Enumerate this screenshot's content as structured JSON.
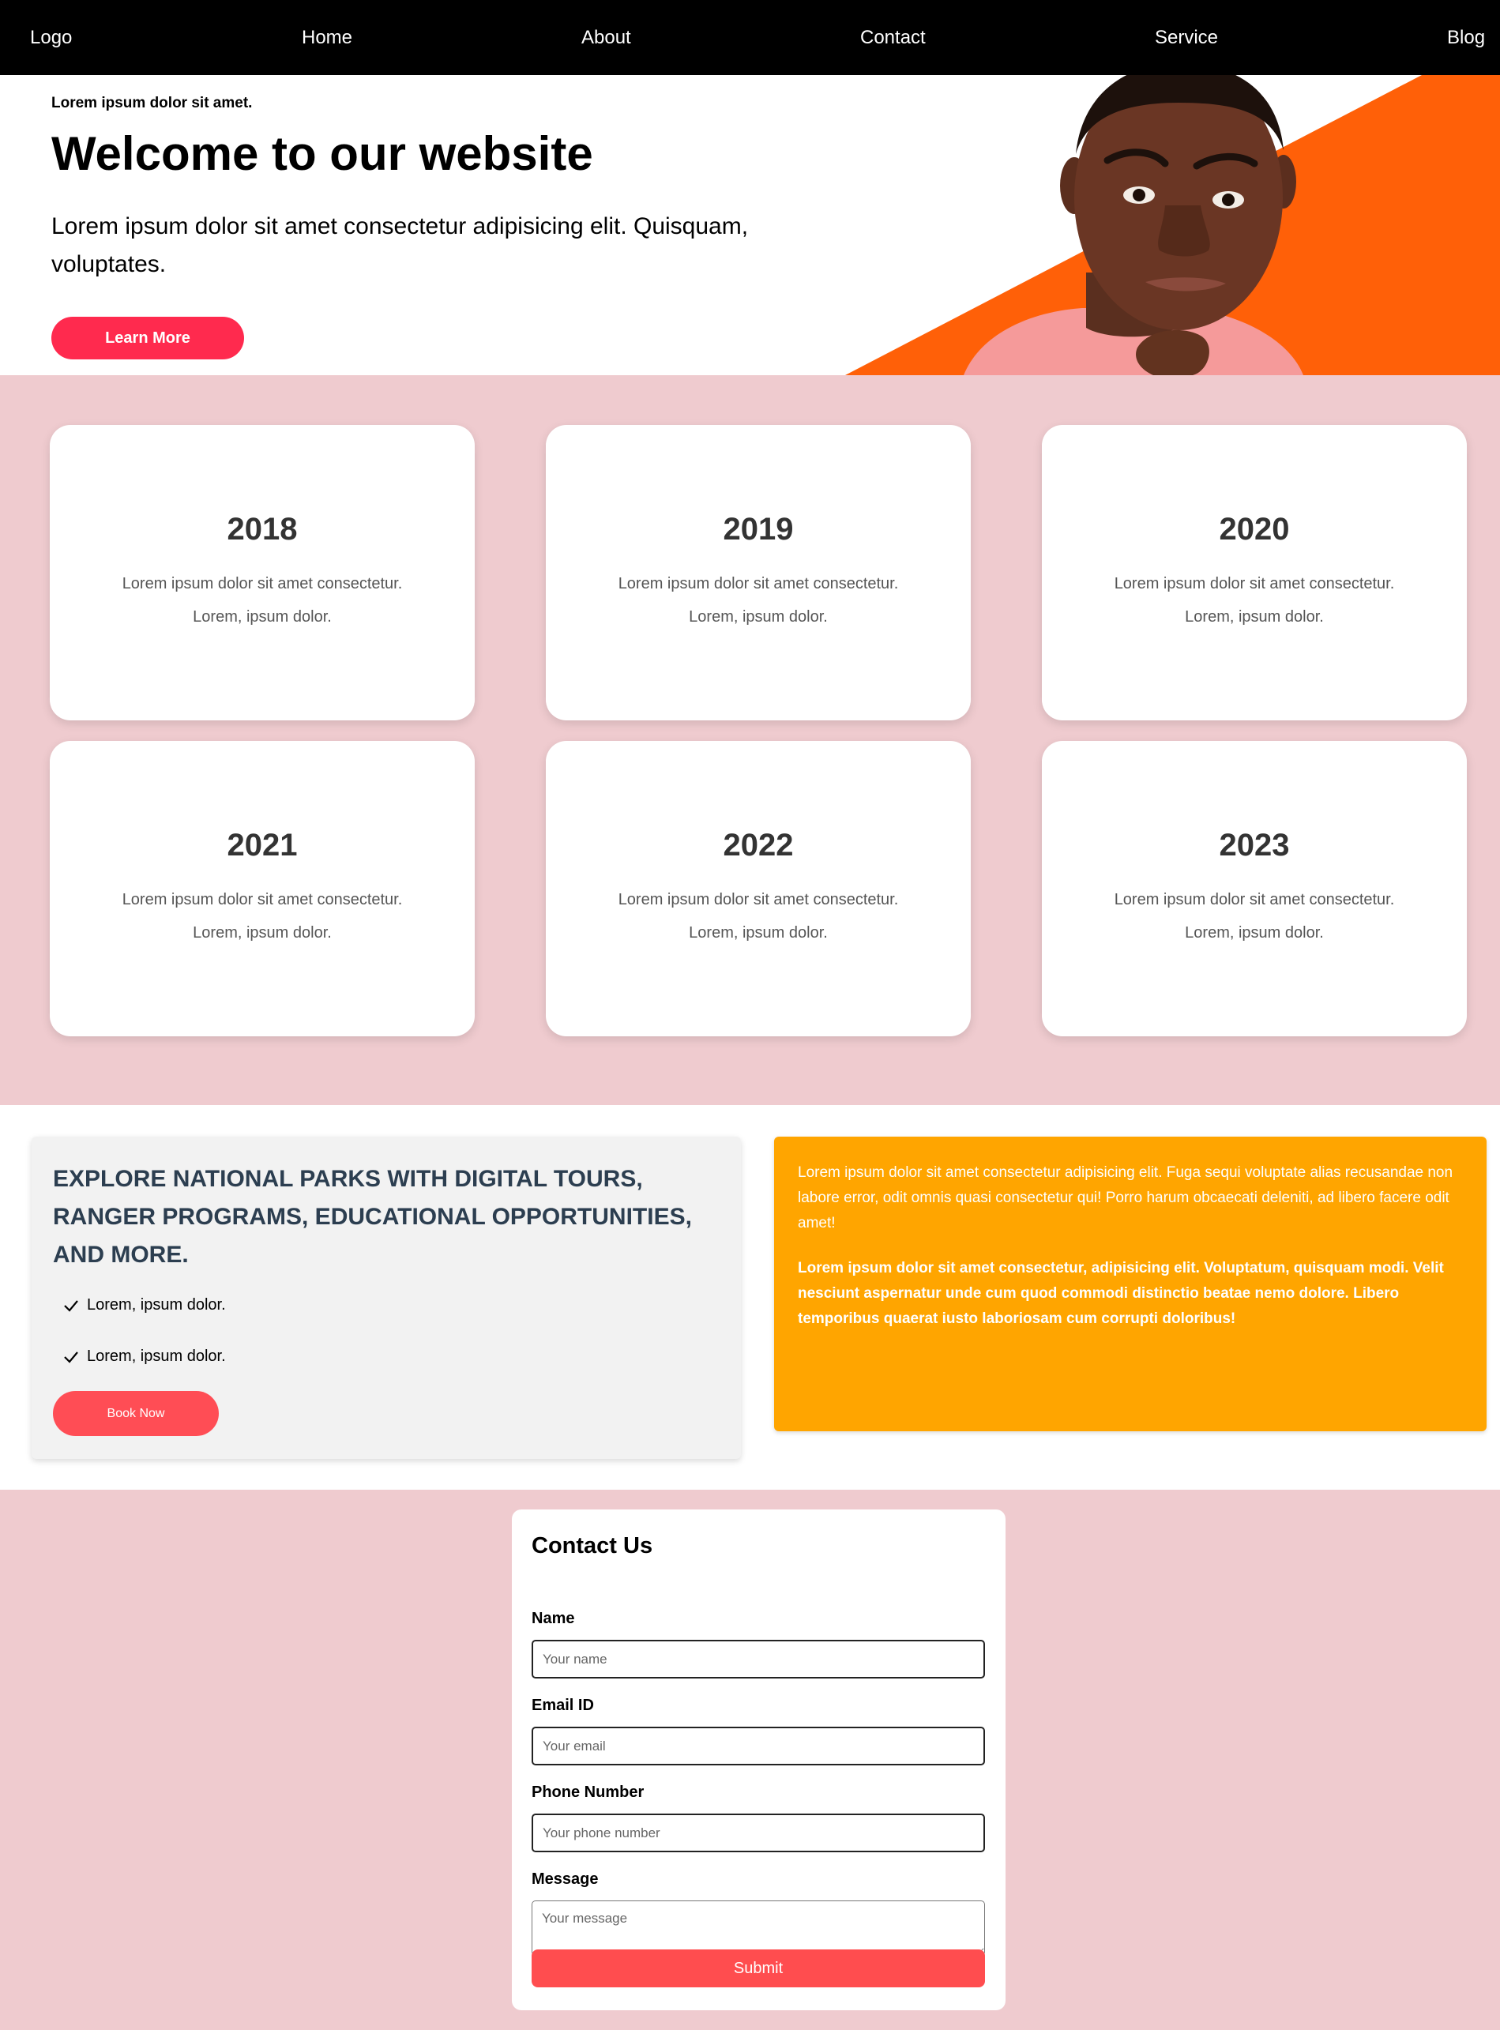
{
  "nav": {
    "logo": "Logo",
    "links": [
      "Home",
      "About",
      "Contact",
      "Service",
      "Blog"
    ]
  },
  "hero": {
    "kicker": "Lorem ipsum dolor sit amet.",
    "title": "Welcome to our website",
    "text": "Lorem ipsum dolor sit amet consectetur adipisicing elit. Quisquam, voluptates.",
    "button_label": "Learn More",
    "accent_color": "#ff6008"
  },
  "cards": [
    {
      "year": "2018",
      "line1": "Lorem ipsum dolor sit amet consectetur.",
      "line2": "Lorem, ipsum dolor."
    },
    {
      "year": "2019",
      "line1": "Lorem ipsum dolor sit amet consectetur.",
      "line2": "Lorem, ipsum dolor."
    },
    {
      "year": "2020",
      "line1": "Lorem ipsum dolor sit amet consectetur.",
      "line2": "Lorem, ipsum dolor."
    },
    {
      "year": "2021",
      "line1": "Lorem ipsum dolor sit amet consectetur.",
      "line2": "Lorem, ipsum dolor."
    },
    {
      "year": "2022",
      "line1": "Lorem ipsum dolor sit amet consectetur.",
      "line2": "Lorem, ipsum dolor."
    },
    {
      "year": "2023",
      "line1": "Lorem ipsum dolor sit amet consectetur.",
      "line2": "Lorem, ipsum dolor."
    }
  ],
  "explore": {
    "heading": "Explore national parks with digital tours, ranger programs, educational opportunities, and more.",
    "items": [
      "Lorem, ipsum dolor.",
      "Lorem, ipsum dolor."
    ],
    "button_label": "Book Now"
  },
  "info": {
    "paragraph": "Lorem ipsum dolor sit amet consectetur adipisicing elit. Fuga sequi voluptate alias recusandae non labore error, odit omnis quasi consectetur qui! Porro harum obcaecati deleniti, ad libero facere odit amet!",
    "bold_paragraph": "Lorem ipsum dolor sit amet consectetur, adipisicing elit. Voluptatum, quisquam modi. Velit nesciunt aspernatur unde cum quod commodi distinctio beatae nemo dolore. Libero temporibus quaerat iusto laboriosam cum corrupti doloribus!"
  },
  "contact": {
    "title": "Contact Us",
    "name_label": "Name",
    "name_placeholder": "Your name",
    "email_label": "Email ID",
    "email_placeholder": "Your email",
    "phone_label": "Phone Number",
    "phone_placeholder": "Your phone number",
    "message_label": "Message",
    "message_placeholder": "Your message",
    "submit_label": "Submit"
  }
}
